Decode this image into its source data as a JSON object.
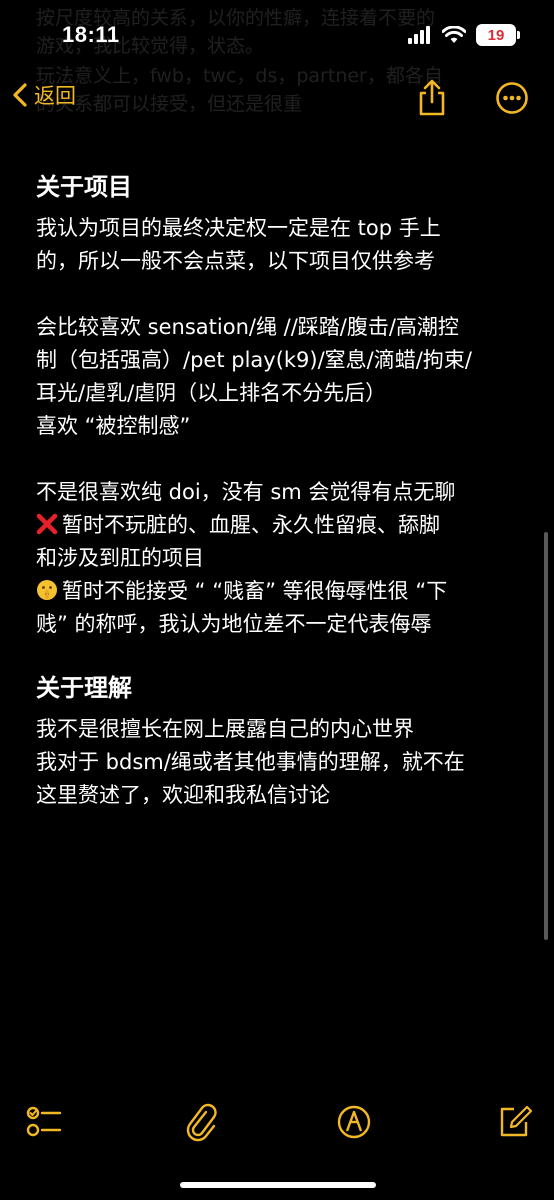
{
  "status_bar": {
    "time": "18:11",
    "battery": "19"
  },
  "faded_text": [
    "按尺度较高的关系，以你的性癖，连接着不要的",
    "游戏，我比较觉得，状态。",
    "玩法意义上，fwb，twc，ds，partner，都各自",
    "的关系都可以接受，但还是很重"
  ],
  "nav": {
    "back_label": "返回"
  },
  "sections": [
    {
      "title": "关于项目",
      "lines": [
        "我认为项目的最终决定权一定是在 top 手上",
        "的，所以一般不会点菜，以下项目仅供参考",
        "",
        "会比较喜欢 sensation/绳 //踩踏/腹击/高潮控",
        "制（包括强高）/pet play(k9)/窒息/滴蜡/拘束/",
        "耳光/虐乳/虐阴（以上排名不分先后）",
        "喜欢 “被控制感”",
        "",
        "不是很喜欢纯 doi，没有 sm 会觉得有点无聊",
        "暂时不玩脏的、血腥、永久性留痕、舔脚",
        "和涉及到肛的项目",
        "暂时不能接受 “ “贱畜” 等很侮辱性很 “下",
        "贱” 的称呼，我认为地位差不一定代表侮辱"
      ]
    },
    {
      "title": "关于理解",
      "lines": [
        "我不是很擅长在网上展露自己的内心世界",
        "我对于 bdsm/绳或者其他事情的理解，就不在",
        "这里赘述了，欢迎和我私信讨论"
      ]
    }
  ],
  "icons": {
    "accent": "#f2b824",
    "cross": "red-cross-mark-icon",
    "shush": "shushing-face-emoji-icon"
  }
}
